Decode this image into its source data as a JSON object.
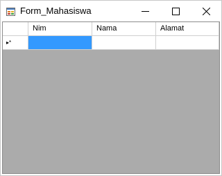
{
  "window": {
    "title": "Form_Mahasiswa"
  },
  "grid": {
    "columns": [
      "Nim",
      "Nama",
      "Alamat"
    ],
    "rows": [
      {
        "indicator": "new-row-icon",
        "cells": [
          "",
          "",
          ""
        ],
        "selected_column": 0
      }
    ],
    "colors": {
      "background": "#ababab",
      "selection": "#3399ff"
    }
  }
}
